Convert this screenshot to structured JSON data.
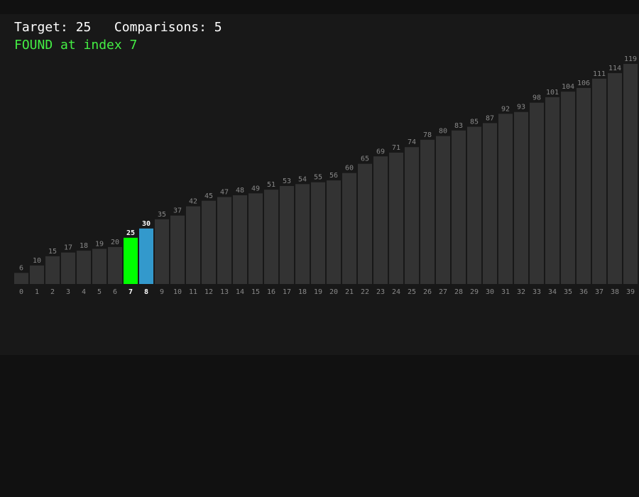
{
  "header": {
    "target_label": "Target:",
    "target_value": "25",
    "comparisons_label": "Comparisons:",
    "comparisons_value": "5",
    "result_text": "FOUND at index 7"
  },
  "colors": {
    "page_bg": "#111111",
    "panel_bg": "#181818",
    "bar_default": "#333333",
    "bar_found": "#00ff00",
    "bar_mid": "#3399cc",
    "result_text": "#44ee44",
    "label_default": "#888888",
    "label_highlight": "#ffffff"
  },
  "search": {
    "found_index": 7,
    "mid_index": 8
  },
  "chart_data": {
    "type": "bar",
    "categories": [
      "0",
      "1",
      "2",
      "3",
      "4",
      "5",
      "6",
      "7",
      "8",
      "9",
      "10",
      "11",
      "12",
      "13",
      "14",
      "15",
      "16",
      "17",
      "18",
      "19",
      "20",
      "21",
      "22",
      "23",
      "24",
      "25",
      "26",
      "27",
      "28",
      "29",
      "30",
      "31",
      "32",
      "33",
      "34",
      "35",
      "36",
      "37",
      "38",
      "39"
    ],
    "values": [
      6,
      10,
      15,
      17,
      18,
      19,
      20,
      25,
      30,
      35,
      37,
      42,
      45,
      47,
      48,
      49,
      51,
      53,
      54,
      55,
      56,
      60,
      65,
      69,
      71,
      74,
      78,
      80,
      83,
      85,
      87,
      92,
      93,
      98,
      101,
      104,
      106,
      111,
      114,
      119
    ],
    "ylim": [
      0,
      119
    ],
    "grid": false,
    "legend": "none"
  }
}
